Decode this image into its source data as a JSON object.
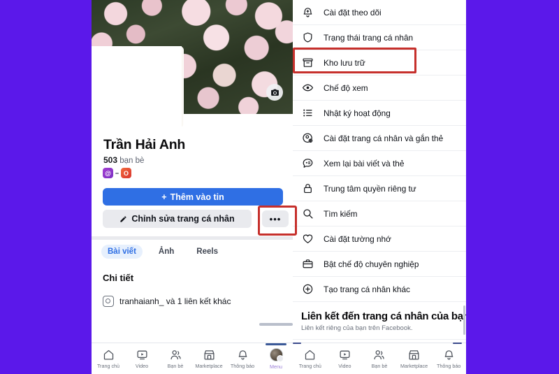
{
  "theme": {
    "background_purple": "#5b18ea",
    "primary_blue": "#2f6fe4",
    "highlight_red": "#c6302c",
    "panel_white": "#ffffff",
    "tab_active_bg": "#e7f0fd"
  },
  "profile": {
    "name": "Trần Hải Anh",
    "friends_count": "503",
    "friends_label": "bạn bè",
    "badges": [
      {
        "name": "threads-badge",
        "glyph": "@",
        "color": "#8e33c9"
      },
      {
        "name": "instagram-badge",
        "glyph": "O",
        "color": "#d8352f"
      }
    ],
    "add_story_button": "Thêm vào tin",
    "add_story_plus": "+",
    "edit_profile_button": "Chỉnh sửa trang cá nhân",
    "more_button": "•••",
    "camera_icon": "camera-icon",
    "tabs": [
      {
        "label": "Bài viết",
        "active": true
      },
      {
        "label": "Ảnh",
        "active": false
      },
      {
        "label": "Reels",
        "active": false
      }
    ],
    "details_heading": "Chi tiết",
    "details_row": "tranhaianh_ và 1 liên kết khác"
  },
  "menu": {
    "items": [
      {
        "label": "Cài đặt theo dõi",
        "icon": "bell-plus-icon",
        "highlighted": false
      },
      {
        "label": "Trạng thái trang cá nhân",
        "icon": "shield-icon",
        "highlighted": false
      },
      {
        "label": "Kho lưu trữ",
        "icon": "archive-box-icon",
        "highlighted": true
      },
      {
        "label": "Chế độ xem",
        "icon": "eye-icon",
        "highlighted": false
      },
      {
        "label": "Nhật ký hoạt động",
        "icon": "list-icon",
        "highlighted": false
      },
      {
        "label": "Cài đặt trang cá nhân và gắn thẻ",
        "icon": "profile-gear-icon",
        "highlighted": false
      },
      {
        "label": "Xem lại bài viết và thẻ",
        "icon": "comment-icon",
        "highlighted": false
      },
      {
        "label": "Trung tâm quyền riêng tư",
        "icon": "lock-icon",
        "highlighted": false
      },
      {
        "label": "Tìm kiếm",
        "icon": "search-icon",
        "highlighted": false
      },
      {
        "label": "Cài đặt tường nhớ",
        "icon": "heart-icon",
        "highlighted": false
      },
      {
        "label": "Bật chế độ chuyên nghiệp",
        "icon": "briefcase-icon",
        "highlighted": false
      },
      {
        "label": "Tạo trang cá nhân khác",
        "icon": "plus-circle-icon",
        "highlighted": false
      }
    ],
    "section_title": "Liên kết đến trang cá nhân của bạn",
    "section_subtitle": "Liên kết riêng của bạn trên Facebook."
  },
  "bottom_nav_left": {
    "items": [
      {
        "label": "Trang chủ",
        "icon": "home-icon",
        "selected": false
      },
      {
        "label": "Video",
        "icon": "video-icon",
        "selected": false
      },
      {
        "label": "Bạn bè",
        "icon": "friends-icon",
        "selected": false
      },
      {
        "label": "Marketplace",
        "icon": "marketplace-icon",
        "selected": false
      },
      {
        "label": "Thông báo",
        "icon": "bell-icon",
        "selected": false
      },
      {
        "label": "Menu",
        "icon": "avatar-menu-icon",
        "selected": true
      }
    ]
  },
  "bottom_nav_right": {
    "items": [
      {
        "label": "Trang chủ",
        "icon": "home-icon"
      },
      {
        "label": "Video",
        "icon": "video-icon"
      },
      {
        "label": "Bạn bè",
        "icon": "friends-icon"
      },
      {
        "label": "Marketplace",
        "icon": "marketplace-icon"
      },
      {
        "label": "Thông báo",
        "icon": "bell-icon"
      }
    ]
  }
}
